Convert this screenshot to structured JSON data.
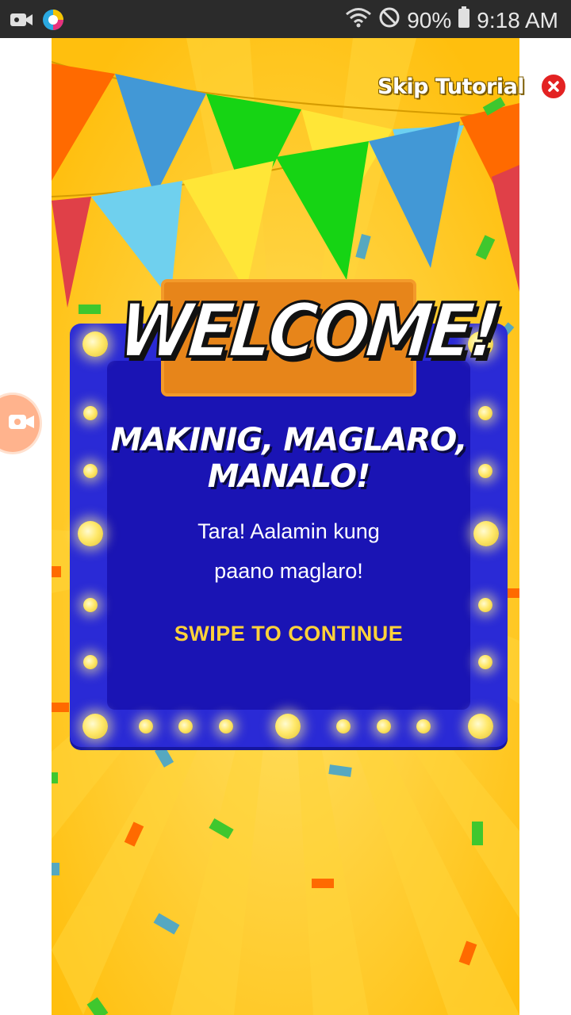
{
  "status_bar": {
    "battery": "90%",
    "time": "9:18 AM",
    "icons": [
      "camera-icon",
      "app-logo-icon",
      "wifi-icon",
      "do-not-disturb-icon",
      "battery-icon"
    ]
  },
  "tutorial": {
    "skip_label": "Skip Tutorial",
    "title": "WELCOME!",
    "headline_line1": "MAKINIG, MAGLARO,",
    "headline_line2": "MANALO!",
    "body_line1": "Tara! Aalamin kung",
    "body_line2": "paano maglaro!",
    "cta": "SWIPE TO CONTINUE"
  },
  "colors": {
    "background": "#ffc81a",
    "board": "#2a2ad6",
    "board_inner": "#1a14b4",
    "banner": "#e7851a",
    "cta": "#ffd23a",
    "close": "#e32222"
  }
}
